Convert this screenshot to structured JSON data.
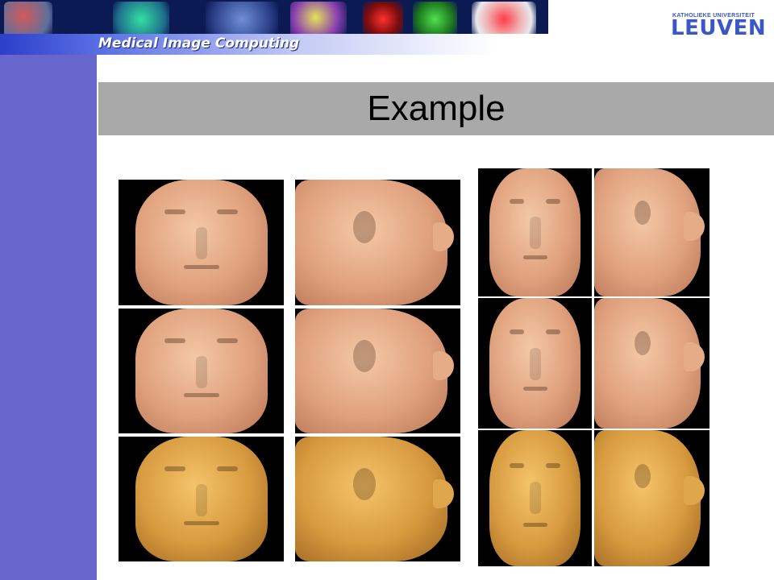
{
  "banner": {
    "title": "Medical Image Computing"
  },
  "logo": {
    "line1": "KATHOLIEKE UNIVERSITEIT",
    "line2": "LEUVEN"
  },
  "slide": {
    "title": "Example"
  },
  "colors": {
    "sidebar": "#6666cc",
    "title_bar": "#a9a9a9",
    "logo": "#3a56c9",
    "banner": "#0b1a52"
  },
  "images": {
    "left_panel": {
      "frontal": [
        "pink",
        "pink",
        "gold"
      ],
      "profile": [
        "pink",
        "pink",
        "gold"
      ]
    },
    "right_panel": {
      "frontal": [
        "pink",
        "pink",
        "gold"
      ],
      "profile": [
        "pink",
        "pink",
        "gold"
      ]
    }
  }
}
